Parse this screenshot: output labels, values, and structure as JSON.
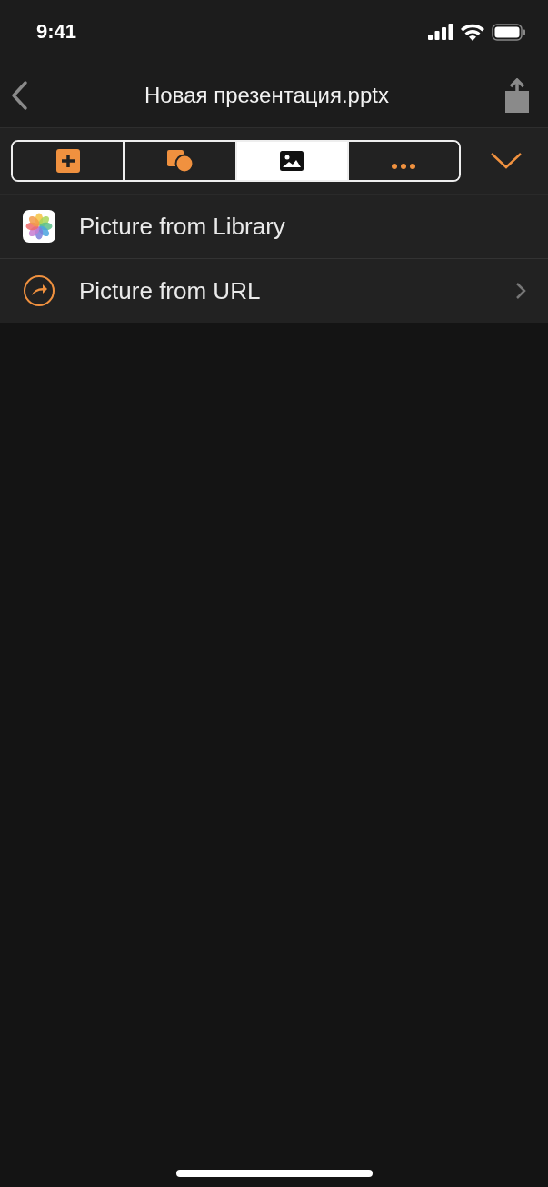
{
  "status_bar": {
    "time": "9:41"
  },
  "nav_bar": {
    "title": "Новая презентация.pptx"
  },
  "tabs": [
    {
      "kind": "insert",
      "selected": false
    },
    {
      "kind": "shapes",
      "selected": false
    },
    {
      "kind": "picture",
      "selected": true
    },
    {
      "kind": "more",
      "selected": false
    }
  ],
  "menu_items": [
    {
      "kind": "library",
      "label": "Picture from Library"
    },
    {
      "kind": "url",
      "label": "Picture from URL"
    }
  ]
}
